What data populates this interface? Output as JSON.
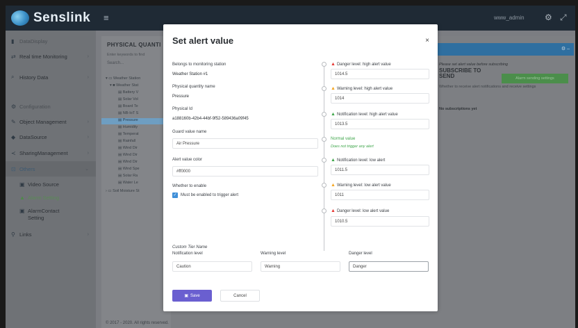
{
  "app": {
    "name": "Senslink",
    "menu_toggle": "≡",
    "user_name": "www_admin"
  },
  "sidebar": {
    "items": [
      {
        "label": "DataDisplay",
        "icon": "bar-chart-icon"
      },
      {
        "label": "Real time Monitoring",
        "icon": "pulse-icon"
      },
      {
        "label": "History Data",
        "icon": "search-icon"
      },
      {
        "label": "Configuration",
        "icon": "gears-icon"
      },
      {
        "label": "Object Management",
        "icon": "wrench-icon"
      },
      {
        "label": "DataSource",
        "icon": "car-icon"
      },
      {
        "label": "SharingManagement",
        "icon": "share-icon"
      },
      {
        "label": "Others",
        "icon": "cube-icon"
      },
      {
        "label": "Video Source",
        "icon": "video-icon"
      },
      {
        "label": "Alarm Setting",
        "icon": "alarm-icon"
      },
      {
        "label": "AlarmContact",
        "icon": "contact-icon"
      },
      {
        "label": "Setting",
        "icon": ""
      },
      {
        "label": "Links",
        "icon": "link-icon"
      }
    ]
  },
  "left_panel": {
    "title": "PHYSICAL QUANTI",
    "hint": "Enter keywords to find",
    "search_placeholder": "Search...",
    "tree": [
      "Weather Station",
      "Weather Stat",
      "Battery V",
      "Solar Vol",
      "Board Te",
      "NB-IoT S",
      "Pressure",
      "Humidity",
      "Temperat",
      "Rainfall",
      "Wind Dir",
      "Wind Dir",
      "Wind Dir",
      "Wind Spe",
      "Solar Ra",
      "Water Le",
      "Soil Moisture St"
    ]
  },
  "right_panel": {
    "note": "Please set alert value before subscribing",
    "subscribe_title": "SUBSCRIBE TO SEND",
    "subscribe_button": "Alarm sending settings",
    "description": "Whether to receive alert notifications and receive settings",
    "no_subscriptions": "No subscriptions yet"
  },
  "footer": {
    "text": "© 2017 - 2020. All rights reserved."
  },
  "modal": {
    "title": "Set alert value",
    "close": "×",
    "station_label": "Belongs to monitoring station",
    "station_value": "Weather Station #1",
    "quantity_label": "Physical quantity name",
    "quantity_value": "Pressure",
    "id_label": "Physical Id",
    "id_value": "a188160b-42b4-44bf-9f52-589436a09f45",
    "guard_label": "Guard value name",
    "guard_value": "Air Pressure",
    "color_label": "Alert value color",
    "color_value": "#ff0000",
    "enable_label": "Whether to enable",
    "enable_checkbox": "Must be enabled to trigger alert",
    "levels": {
      "danger_high_label": "Danger level: high alert value",
      "danger_high_value": "1014.5",
      "warning_high_label": "Warning level: high alert value",
      "warning_high_value": "1014",
      "notification_high_label": "Notification level: high alert value",
      "notification_high_value": "1013.5",
      "normal_title": "Normal value",
      "normal_sub": "Does not trigger any alert",
      "notification_low_label": "Notification level: low alert",
      "notification_low_value": "1011.5",
      "warning_low_label": "Warning level: low alert value",
      "warning_low_value": "1011",
      "danger_low_label": "Danger level: low alert value",
      "danger_low_value": "1010.5"
    },
    "custom_tier": {
      "title": "Custom Tier Name",
      "notification_label": "Notification level",
      "notification_value": "Caution",
      "warning_label": "Warning level",
      "warning_value": "Warning",
      "danger_label": "Danger level",
      "danger_value": "Danger"
    },
    "save_label": "Save",
    "cancel_label": "Cancel"
  },
  "colors": {
    "danger": "#e53935",
    "warning": "#f5a623",
    "notification": "#3fa64b",
    "primary": "#6a5fd0"
  }
}
